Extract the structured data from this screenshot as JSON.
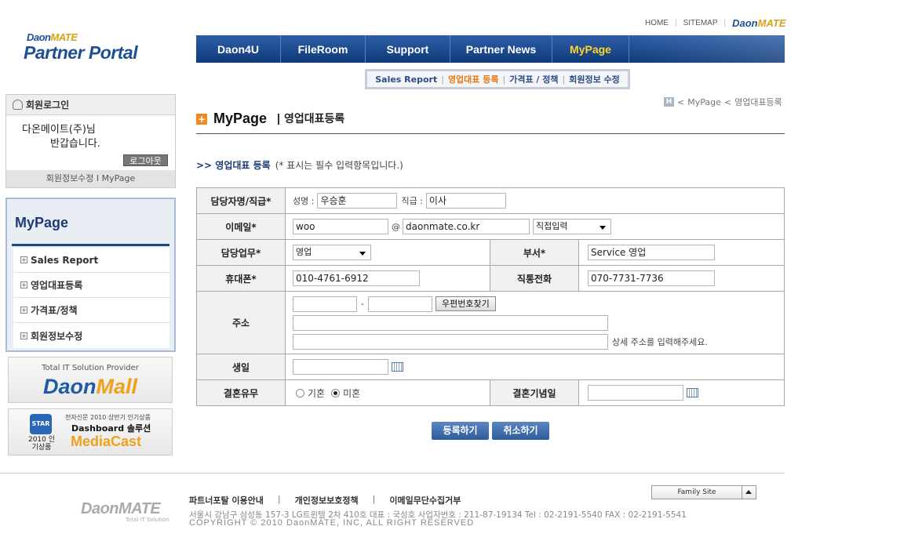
{
  "logo": {
    "brand_daon": "Daon",
    "brand_mate": "MATE",
    "title": "Partner Portal"
  },
  "utility": {
    "home": "HOME",
    "sitemap": "SITEMAP",
    "brand_daon": "Daon",
    "brand_mate": "MATE"
  },
  "gnb": {
    "items": [
      "Daon4U",
      "FileRoom",
      "Support",
      "Partner News",
      "MyPage"
    ],
    "active": "MyPage"
  },
  "subnav": {
    "items": [
      "Sales Report",
      "영업대표 등록",
      "가격표 / 정책",
      "회원정보 수정"
    ],
    "active_index": 1
  },
  "breadcrumb": {
    "home_icon": "H",
    "items": [
      "MyPage",
      "영업대표등록"
    ]
  },
  "page": {
    "title": "MyPage",
    "subtitle": "영업대표등록"
  },
  "section": {
    "title": ">> 영업대표 등록",
    "note": "(* 표시는 필수 입력항목입니다.)"
  },
  "form": {
    "manager": {
      "label": "담당자명/직급*",
      "name_label": "성명 :",
      "name_value": "우승훈",
      "rank_label": "직급 :",
      "rank_value": "이사"
    },
    "email": {
      "label": "이메일*",
      "id_value": "woo",
      "at": "@",
      "domain_value": "daonmate.co.kr",
      "domain_select": "직접입력"
    },
    "duty": {
      "label": "담당업무*",
      "value": "영업"
    },
    "dept": {
      "label": "부서*",
      "value": "Service 영업"
    },
    "mobile": {
      "label": "휴대폰*",
      "value": "010-4761-6912"
    },
    "direct": {
      "label": "직통전화",
      "value": "070-7731-7736"
    },
    "address": {
      "label": "주소",
      "zip1": "",
      "dash": "-",
      "zip2": "",
      "zip_button": "우편번호찾기",
      "line1": "",
      "line2": "",
      "hint": "상세 주소를 입력해주세요."
    },
    "birthday": {
      "label": "생일",
      "value": ""
    },
    "marital": {
      "label": "결혼유무",
      "options": [
        "기혼",
        "미혼"
      ],
      "selected": "미혼"
    },
    "anniversary": {
      "label": "결혼기념일",
      "value": ""
    }
  },
  "buttons": {
    "submit": "등록하기",
    "cancel": "취소하기"
  },
  "login": {
    "header": "회원로그인",
    "greeting_line1": "다온메이트(주)님",
    "greeting_line2": "반갑습니다.",
    "logout": "로그아웃",
    "footer": "회원정보수정 I MyPage"
  },
  "lnb": {
    "title": "MyPage",
    "items": [
      "Sales Report",
      "영업대표등록",
      "가격표/정책",
      "회원정보수정"
    ]
  },
  "banner_mall": {
    "tagline": "Total IT Solution Provider",
    "brand_daon": "Daon",
    "brand_mall": "Mall"
  },
  "banner_mediacast": {
    "badge": "STAR",
    "year": "2010 인기상품",
    "line1": "전자신문 2010 상반기 인기상품",
    "line2": "Dashboard 솔루션",
    "line3": "MediaCast"
  },
  "footer": {
    "logo": "DaonMATE",
    "logo_sub": "Total IT Solution",
    "links": [
      "파트너포탈 이용안내",
      "개인정보보호정책",
      "이메일무단수집거부"
    ],
    "separator": "|",
    "address": "서울시 강남구 삼성동 157-3 LG트윈텔 2차 410호   대표 : 국성호  사업자번호 : 211-87-19134    Tel : 02-2191-5540    FAX : 02-2191-5541",
    "copyright": "COPYRIGHT © 2010 DaonMATE, INC, ALL RIGHT RESERVED",
    "family_site": "Family Site"
  }
}
